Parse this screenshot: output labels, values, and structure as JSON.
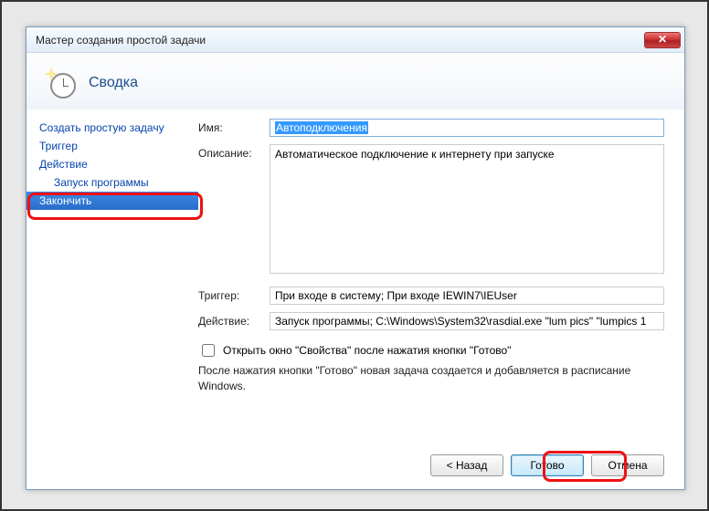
{
  "window": {
    "title": "Мастер создания простой задачи",
    "close_symbol": "✕"
  },
  "header": {
    "title": "Сводка"
  },
  "sidebar": {
    "items": [
      {
        "label": "Создать простую задачу",
        "indent": false,
        "selected": false
      },
      {
        "label": "Триггер",
        "indent": false,
        "selected": false
      },
      {
        "label": "Действие",
        "indent": false,
        "selected": false
      },
      {
        "label": "Запуск программы",
        "indent": true,
        "selected": false
      },
      {
        "label": "Закончить",
        "indent": false,
        "selected": true
      }
    ]
  },
  "form": {
    "name_label": "Имя:",
    "name_value": "Автоподключения",
    "description_label": "Описание:",
    "description_value": "Автоматическое подключение к интернету при запуске",
    "trigger_label": "Триггер:",
    "trigger_value": "При входе в систему; При входе IEWIN7\\IEUser",
    "action_label": "Действие:",
    "action_value": "Запуск программы; C:\\Windows\\System32\\rasdial.exe \"lum pics\" \"lumpics 1",
    "checkbox_label": "Открыть окно \"Свойства\" после нажатия кнопки \"Готово\"",
    "info_text": "После нажатия кнопки \"Готово\" новая задача создается и добавляется в расписание Windows."
  },
  "buttons": {
    "back": "< Назад",
    "finish": "Готово",
    "cancel": "Отмена"
  }
}
